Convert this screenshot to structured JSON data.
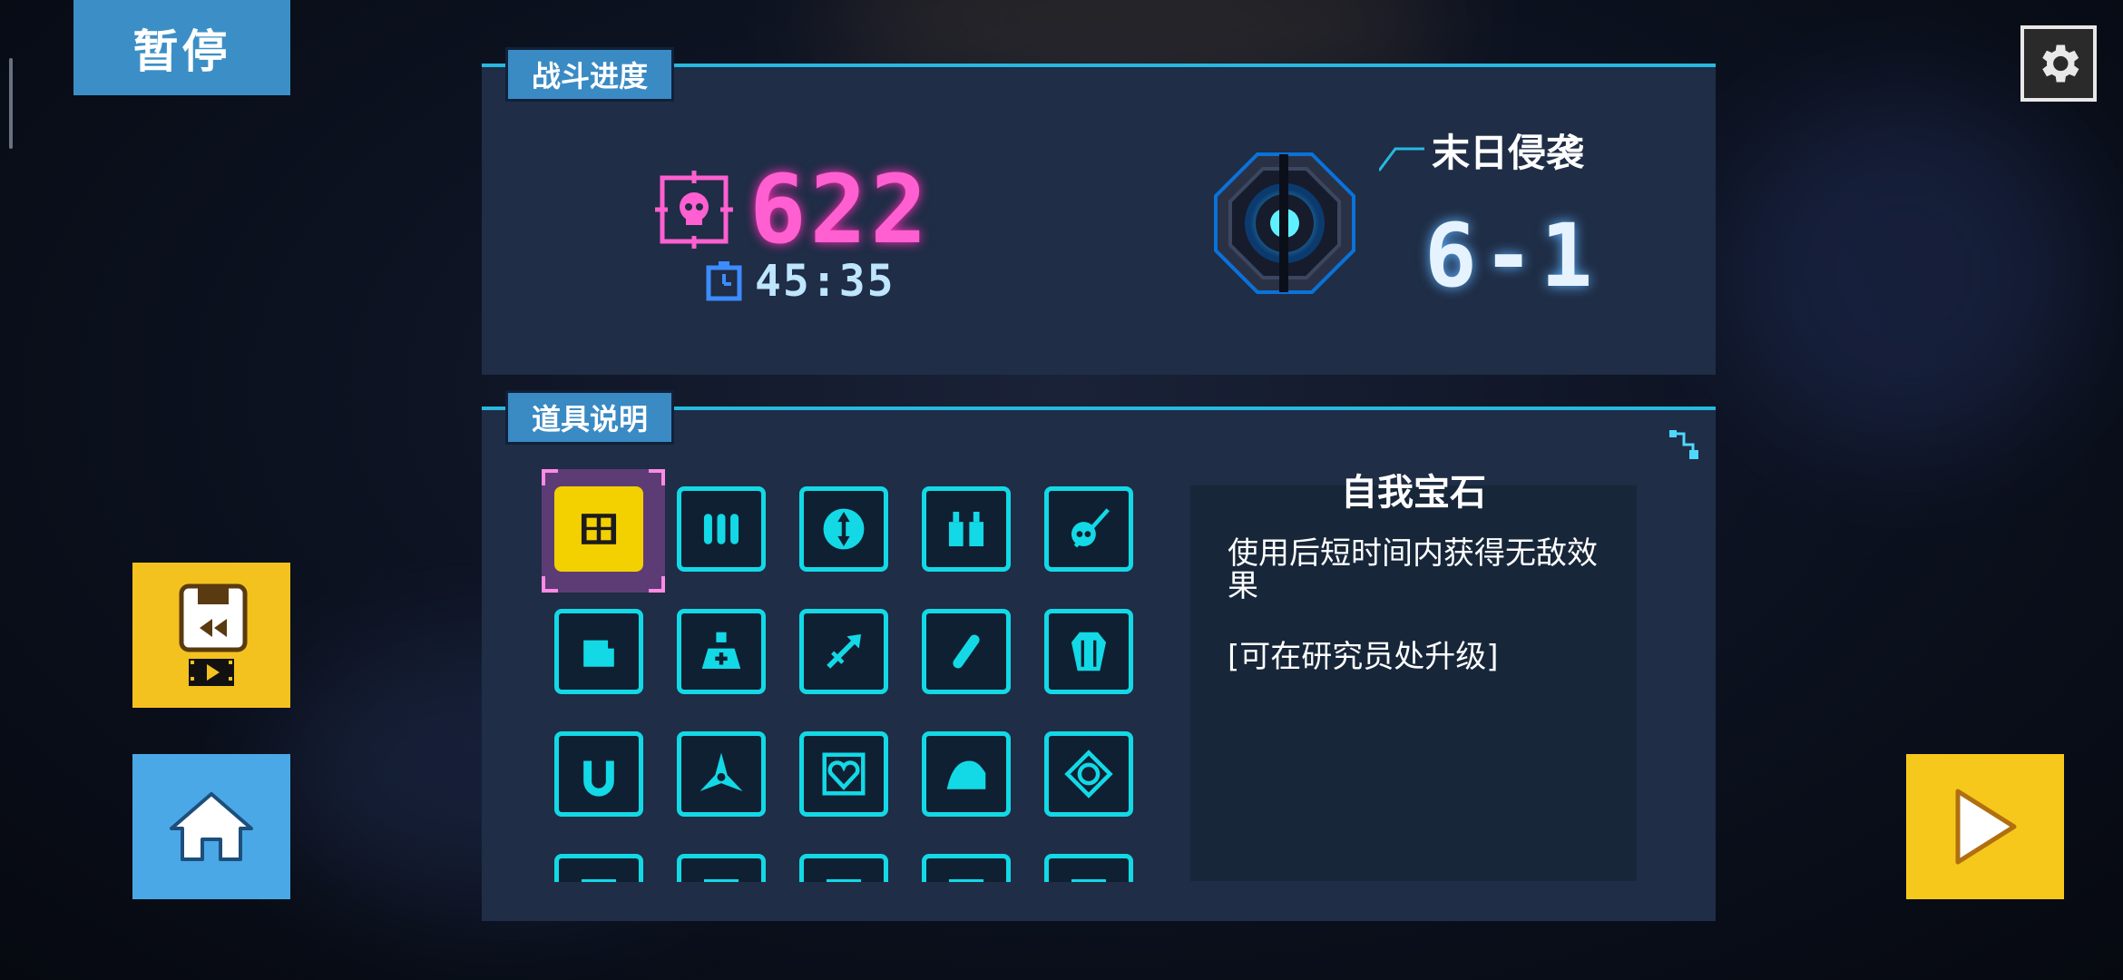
{
  "pause_label": "暂停",
  "progress_panel": {
    "tag": "战斗进度",
    "kills": "622",
    "timer": "45:35",
    "stage_name": "末日侵袭",
    "stage_number": "6-1"
  },
  "items_panel": {
    "tag": "道具说明",
    "selected_index": 0,
    "items": [
      {
        "icon": "self-gem-icon"
      },
      {
        "icon": "ammo-icon"
      },
      {
        "icon": "vertical-arrows-icon"
      },
      {
        "icon": "bottles-icon"
      },
      {
        "icon": "skull-sword-icon"
      },
      {
        "icon": "fist-icon"
      },
      {
        "icon": "potion-icon"
      },
      {
        "icon": "arrow-target-icon"
      },
      {
        "icon": "syringe-icon"
      },
      {
        "icon": "coffin-icon"
      },
      {
        "icon": "magnet-icon"
      },
      {
        "icon": "shuriken-icon"
      },
      {
        "icon": "heart-icon"
      },
      {
        "icon": "muscle-icon"
      },
      {
        "icon": "diamond-eye-icon"
      },
      {
        "icon": "item-16-icon"
      },
      {
        "icon": "item-17-icon"
      },
      {
        "icon": "item-18-icon"
      },
      {
        "icon": "item-19-icon"
      },
      {
        "icon": "item-20-icon"
      }
    ],
    "detail": {
      "title": "自我宝石",
      "description": "使用后短时间内获得无敌效果",
      "note": "[可在研究员处升级]"
    }
  },
  "buttons": {
    "replay": "replay-video-icon",
    "home": "home-icon",
    "continue": "play-icon",
    "settings": "gear-icon"
  },
  "colors": {
    "accent_cyan": "#13d9e6",
    "kill_pink": "#ff5fd0",
    "selected_yellow": "#f3d000",
    "tag_blue": "#3a8ac4",
    "panel_bg": "#1f2d46"
  }
}
